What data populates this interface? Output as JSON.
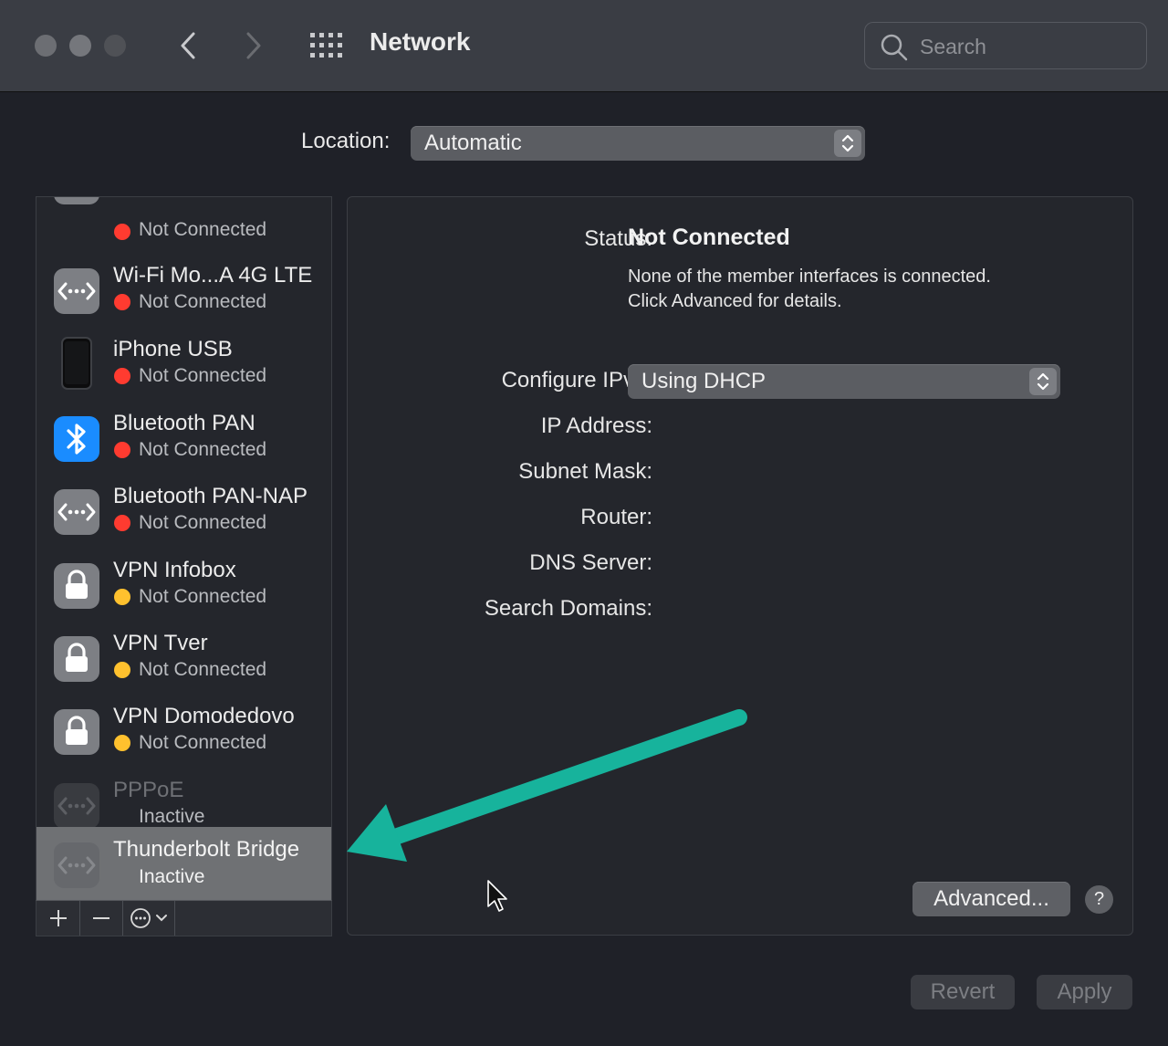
{
  "window": {
    "title": "Network"
  },
  "search": {
    "placeholder": "Search"
  },
  "location": {
    "label": "Location:",
    "value": "Automatic"
  },
  "services": [
    {
      "name": "",
      "status": "Not Connected",
      "status_color": "#ff3b30",
      "icon": "ethernet-arrows-icon"
    },
    {
      "name": "Wi-Fi Mo...A 4G LTE",
      "status": "Not Connected",
      "status_color": "#ff3b30",
      "icon": "ethernet-arrows-icon"
    },
    {
      "name": "iPhone USB",
      "status": "Not Connected",
      "status_color": "#ff3b30",
      "icon": "iphone-icon"
    },
    {
      "name": "Bluetooth PAN",
      "status": "Not Connected",
      "status_color": "#ff3b30",
      "icon": "bluetooth-icon"
    },
    {
      "name": "Bluetooth PAN-NAP",
      "status": "Not Connected",
      "status_color": "#ff3b30",
      "icon": "ethernet-arrows-icon"
    },
    {
      "name": "VPN Infobox",
      "status": "Not Connected",
      "status_color": "#ffc12e",
      "icon": "lock-icon"
    },
    {
      "name": "VPN Tver",
      "status": "Not Connected",
      "status_color": "#ffc12e",
      "icon": "lock-icon"
    },
    {
      "name": "VPN Domodedovo",
      "status": "Not Connected",
      "status_color": "#ffc12e",
      "icon": "lock-icon"
    },
    {
      "name": "PPPoE",
      "status": "Inactive",
      "icon": "ethernet-arrows-icon"
    },
    {
      "name": "Thunderbolt Bridge",
      "status": "Inactive",
      "icon": "ethernet-arrows-icon",
      "selected": true
    }
  ],
  "detail": {
    "status_label": "Status:",
    "status_value": "Not Connected",
    "status_desc_1": "None of the member interfaces is connected.",
    "status_desc_2": "Click Advanced for details.",
    "ipv4_label": "Configure IPv4:",
    "ipv4_value": "Using DHCP",
    "ip_label": "IP Address:",
    "subnet_label": "Subnet Mask:",
    "router_label": "Router:",
    "dns_label": "DNS Server:",
    "search_domains_label": "Search Domains:",
    "advanced_label": "Advanced...",
    "help_label": "?"
  },
  "footer": {
    "revert_label": "Revert",
    "apply_label": "Apply"
  },
  "colors": {
    "arrow": "#17b39c",
    "status_red": "#ff3b30",
    "status_yellow": "#ffc12e"
  }
}
